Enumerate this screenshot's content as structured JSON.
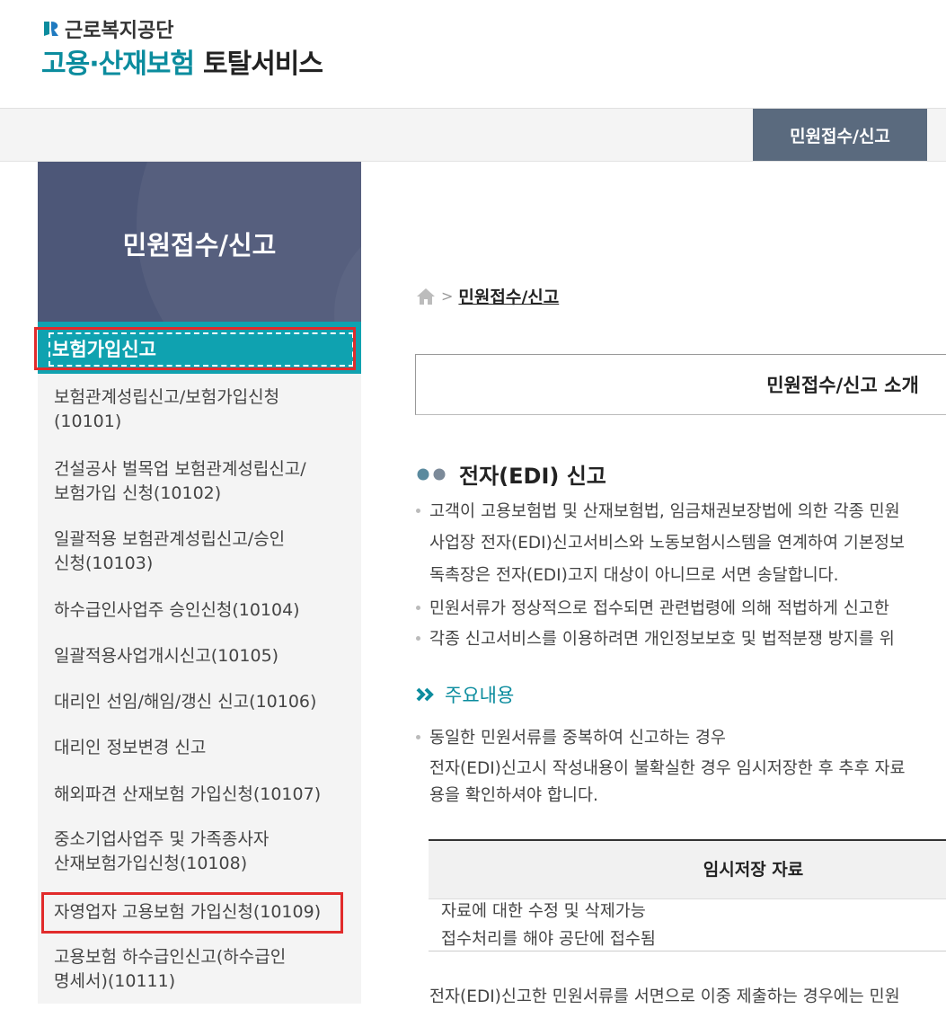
{
  "header": {
    "org_name": "근로복지공단",
    "service_teal": "고용·산재보험",
    "service_dark": "토탈서비스"
  },
  "nav": {
    "active_label": "민원접수/신고"
  },
  "sidebar": {
    "title": "민원접수/신고",
    "active_item": "보험가입신고",
    "items": [
      {
        "line1": "보험관계성립신고/보험가입신청",
        "line2": "(10101)"
      },
      {
        "line1": "건설공사 벌목업 보험관계성립신고/",
        "line2": "보험가입 신청(10102)"
      },
      {
        "line1": "일괄적용 보험관계성립신고/승인",
        "line2": "신청(10103)"
      },
      {
        "line1": "하수급인사업주 승인신청(10104)",
        "line2": ""
      },
      {
        "line1": "일괄적용사업개시신고(10105)",
        "line2": ""
      },
      {
        "line1": "대리인 선임/해임/갱신 신고(10106)",
        "line2": ""
      },
      {
        "line1": "대리인 정보변경 신고",
        "line2": ""
      },
      {
        "line1": "해외파견 산재보험 가입신청(10107)",
        "line2": ""
      },
      {
        "line1": "중소기업사업주 및 가족종사자",
        "line2": "산재보험가입신청(10108)"
      },
      {
        "line1": "자영업자 고용보험 가입신청(10109)",
        "line2": ""
      },
      {
        "line1": "고용보험 하수급인신고(하수급인",
        "line2": "명세서)(10111)"
      }
    ]
  },
  "breadcrumb": {
    "current": "민원접수/신고"
  },
  "main": {
    "intro_title": "민원접수/신고 소개",
    "section_title": "전자(EDI) 신고",
    "para1": [
      "고객이 고용보험법 및 산재보험법, 임금채권보장법에 의한 각종 민원",
      "사업장 전자(EDI)신고서비스와 노동보험시스템을 연계하여 기본정보",
      "독촉장은 전자(EDI)고지 대상이 아니므로 서면 송달합니다."
    ],
    "para2": "민원서류가 정상적으로 접수되면 관련법령에 의해 적법하게 신고한",
    "para3": "각종 신고서비스를 이용하려면 개인정보보호 및 법적분쟁 방지를 위",
    "sub_title": "주요내용",
    "content": [
      "동일한 민원서류를 중복하여 신고하는 경우",
      "전자(EDI)신고시 작성내용이 불확실한 경우 임시저장한 후 추후 자료",
      "용을 확인하셔야 합니다."
    ],
    "table": {
      "header": "임시저장 자료",
      "rows": [
        "자료에 대한 수정 및 삭제가능",
        "접수처리를 해야 공단에 접수됨"
      ]
    },
    "footer_line": "전자(EDI)신고한 민원서류를 서면으로 이중 제출하는 경우에는 민원"
  },
  "colors": {
    "teal": "#0b8c9e",
    "nav_active_bg": "#5a6a7e",
    "sidebar_hero_bg": "#4d5778",
    "sidebar_active_bg": "#0fa2b0",
    "highlight_red": "#e12b2b"
  }
}
